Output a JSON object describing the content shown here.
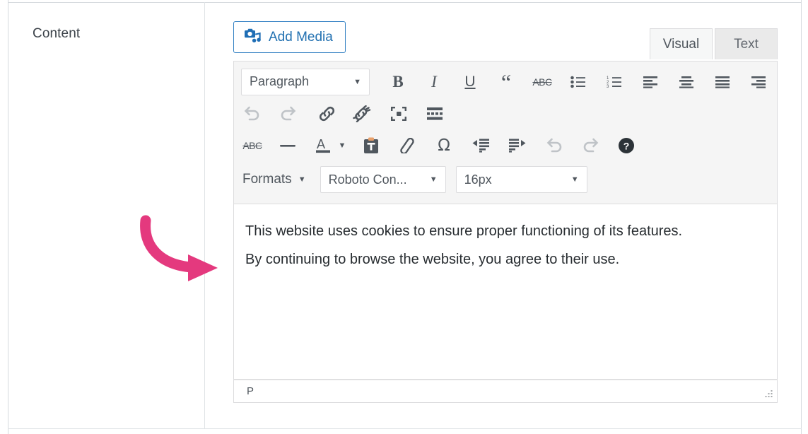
{
  "page": {
    "left_label": "Content"
  },
  "annotation": {
    "name": "pink-curved-arrow",
    "color": "#e4397e",
    "points_to": "editor-content-area"
  },
  "editor": {
    "add_media_label": "Add Media",
    "add_media_icon": "camera-music-icon",
    "tabs": [
      {
        "label": "Visual",
        "active": true
      },
      {
        "label": "Text",
        "active": false
      }
    ],
    "toolbar": {
      "row1": {
        "block_format": {
          "value": "Paragraph",
          "caret": "▾"
        },
        "buttons": [
          {
            "name": "bold-icon",
            "label": "B"
          },
          {
            "name": "italic-icon",
            "label": "I"
          },
          {
            "name": "underline-icon",
            "label": "U"
          },
          {
            "name": "blockquote-icon",
            "label": "“"
          },
          {
            "name": "strikethrough-icon",
            "label": "ABC"
          },
          {
            "name": "bulleted-list-icon",
            "label": ""
          },
          {
            "name": "numbered-list-icon",
            "label": ""
          },
          {
            "name": "align-left-icon",
            "label": ""
          },
          {
            "name": "align-center-icon",
            "label": ""
          },
          {
            "name": "align-justify-icon",
            "label": ""
          },
          {
            "name": "align-right-icon",
            "label": ""
          }
        ]
      },
      "row2": {
        "buttons": [
          {
            "name": "undo-icon",
            "disabled": true
          },
          {
            "name": "redo-icon",
            "disabled": true
          },
          {
            "name": "insert-link-icon",
            "disabled": false
          },
          {
            "name": "remove-link-icon",
            "disabled": false
          },
          {
            "name": "fullscreen-icon",
            "disabled": false
          },
          {
            "name": "read-more-icon",
            "disabled": false
          }
        ]
      },
      "row3": {
        "buttons": [
          {
            "name": "strikethrough-icon",
            "label": "ABC",
            "disabled": false
          },
          {
            "name": "horizontal-rule-icon",
            "disabled": false
          },
          {
            "name": "text-color-icon",
            "label": "A",
            "disabled": false
          },
          {
            "name": "text-color-caret-icon",
            "disabled": false
          },
          {
            "name": "paste-as-text-icon",
            "disabled": false
          },
          {
            "name": "clear-formatting-icon",
            "disabled": false
          },
          {
            "name": "special-character-icon",
            "label": "Ω",
            "disabled": false
          },
          {
            "name": "outdent-icon",
            "disabled": false
          },
          {
            "name": "indent-icon",
            "disabled": false
          },
          {
            "name": "undo-icon",
            "disabled": true
          },
          {
            "name": "redo-icon",
            "disabled": true
          },
          {
            "name": "keyboard-shortcuts-help-icon",
            "label": "?",
            "disabled": false
          }
        ]
      },
      "row4": {
        "formats_label": "Formats",
        "formats_caret": "▾",
        "font_family": {
          "value": "Roboto Con...",
          "caret": "▾"
        },
        "font_size": {
          "value": "16px",
          "caret": "▾"
        }
      }
    },
    "content": {
      "line1": "This website uses cookies to ensure proper functioning of its features.",
      "line2": "By continuing to browse the website, you agree to their use."
    },
    "statusbar": {
      "path": "P",
      "resize_handle": "resize-grip-icon"
    }
  },
  "colors": {
    "accent_blue": "#2271b1",
    "annotation_pink": "#e4397e",
    "toolbar_bg": "#f5f5f5",
    "border": "#dcdcde",
    "text": "#50575e"
  }
}
